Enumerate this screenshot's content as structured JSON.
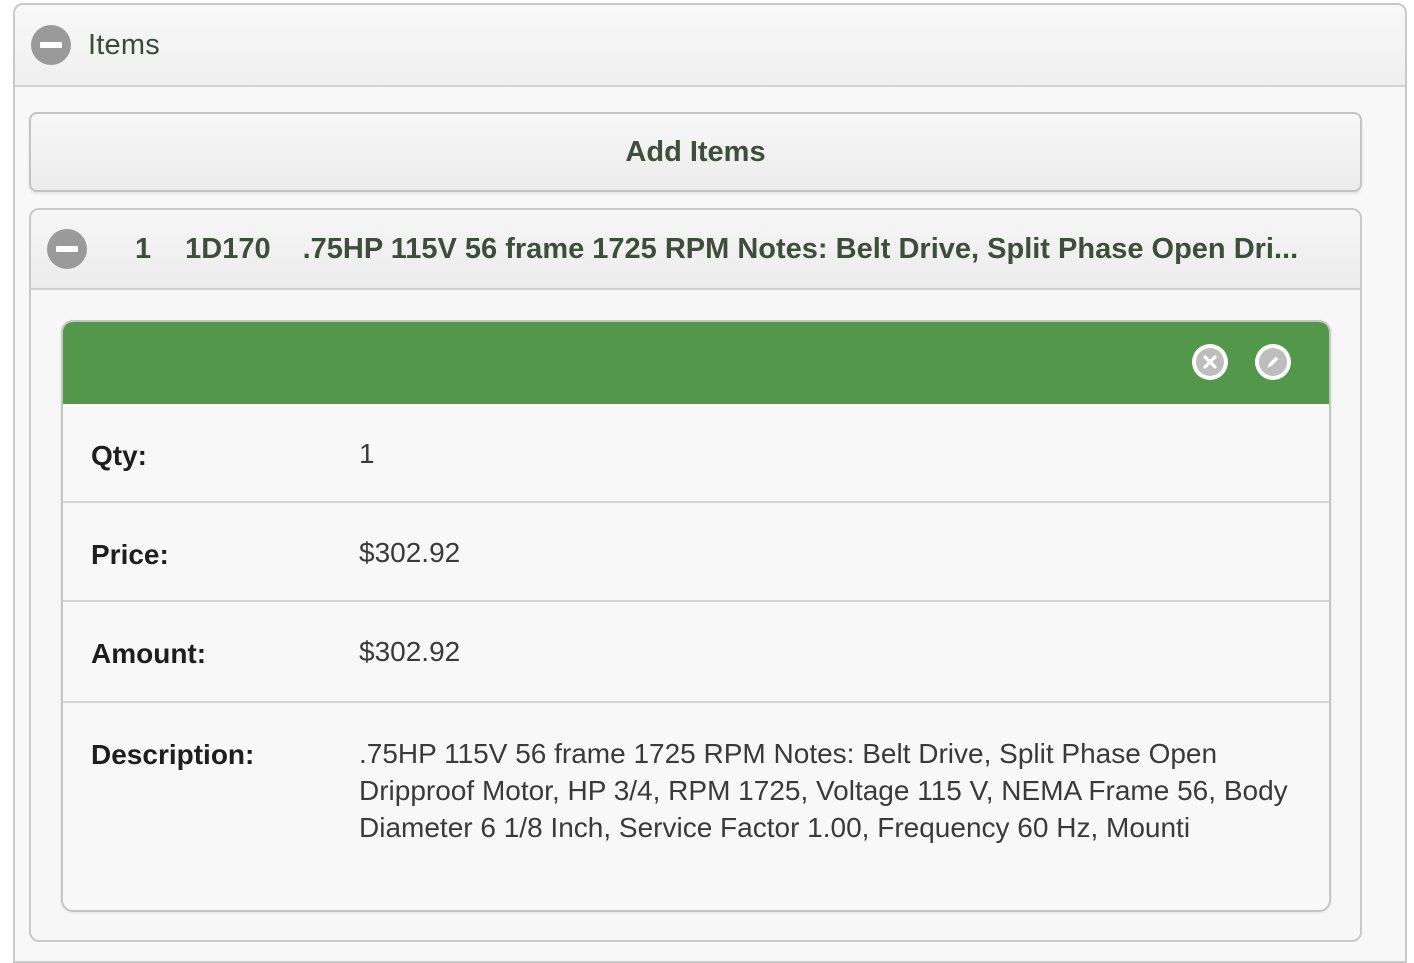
{
  "items_panel": {
    "title": "Items",
    "collapse_icon": "minus-circle-icon"
  },
  "add_items": {
    "label": "Add Items"
  },
  "item": {
    "collapse_icon": "minus-circle-icon",
    "number": "1",
    "sku": "1D170",
    "summary": ".75HP 115V 56 frame 1725 RPM Notes: Belt Drive, Split Phase Open Dri...",
    "header_color": "#53974a",
    "actions": [
      {
        "name": "delete",
        "icon": "close-circle-icon"
      },
      {
        "name": "edit",
        "icon": "pencil-circle-icon"
      }
    ],
    "fields": {
      "qty_label": "Qty:",
      "qty_value": "1",
      "price_label": "Price:",
      "price_value": "$302.92",
      "amount_label": "Amount:",
      "amount_value": "$302.92",
      "description_label": "Description:",
      "description_value": ".75HP 115V 56 frame 1725 RPM Notes: Belt Drive, Split Phase Open Dripproof Motor, HP 3/4, RPM 1725, Voltage 115 V, NEMA Frame 56, Body Diameter 6 1/8 Inch, Service Factor 1.00, Frequency 60 Hz, Mounti"
    }
  }
}
